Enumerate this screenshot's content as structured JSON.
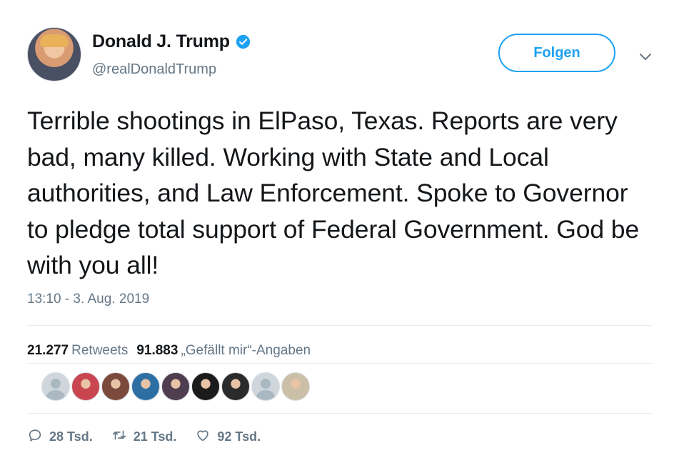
{
  "author": {
    "display_name": "Donald J. Trump",
    "handle": "@realDonaldTrump",
    "verified_icon": "verified-badge-icon",
    "avatar": "avatar"
  },
  "follow_button": {
    "label": "Folgen"
  },
  "menu_icon": "chevron-down-icon",
  "tweet": {
    "text": "Terrible shootings in ElPaso, Texas. Reports are very bad, many killed. Working with State and Local authorities, and Law Enforcement. Spoke to Governor to pledge total support of Federal Government. God be with you all!",
    "timestamp": "13:10 - 3. Aug. 2019"
  },
  "stats": {
    "retweets_count": "21.277",
    "retweets_label": "Retweets",
    "likes_count": "91.883",
    "likes_label": "„Gefällt mir“-Angaben"
  },
  "likers": [
    {
      "color": "#cfd6dc",
      "kind": "default"
    },
    {
      "color": "#c9454f",
      "kind": "photo"
    },
    {
      "color": "#7b4a3d",
      "kind": "photo"
    },
    {
      "color": "#2d6fa3",
      "kind": "photo"
    },
    {
      "color": "#4f3e4f",
      "kind": "photo"
    },
    {
      "color": "#1b1b1b",
      "kind": "photo"
    },
    {
      "color": "#2b2b2b",
      "kind": "photo"
    },
    {
      "color": "#cfd6dc",
      "kind": "default"
    },
    {
      "color": "#cbbfa7",
      "kind": "photo"
    }
  ],
  "actions": {
    "reply_count": "28 Tsd.",
    "retweet_count": "21 Tsd.",
    "like_count": "92 Tsd."
  },
  "colors": {
    "accent": "#1da1f2",
    "secondary_text": "#657786",
    "divider": "#e6ecf0"
  }
}
